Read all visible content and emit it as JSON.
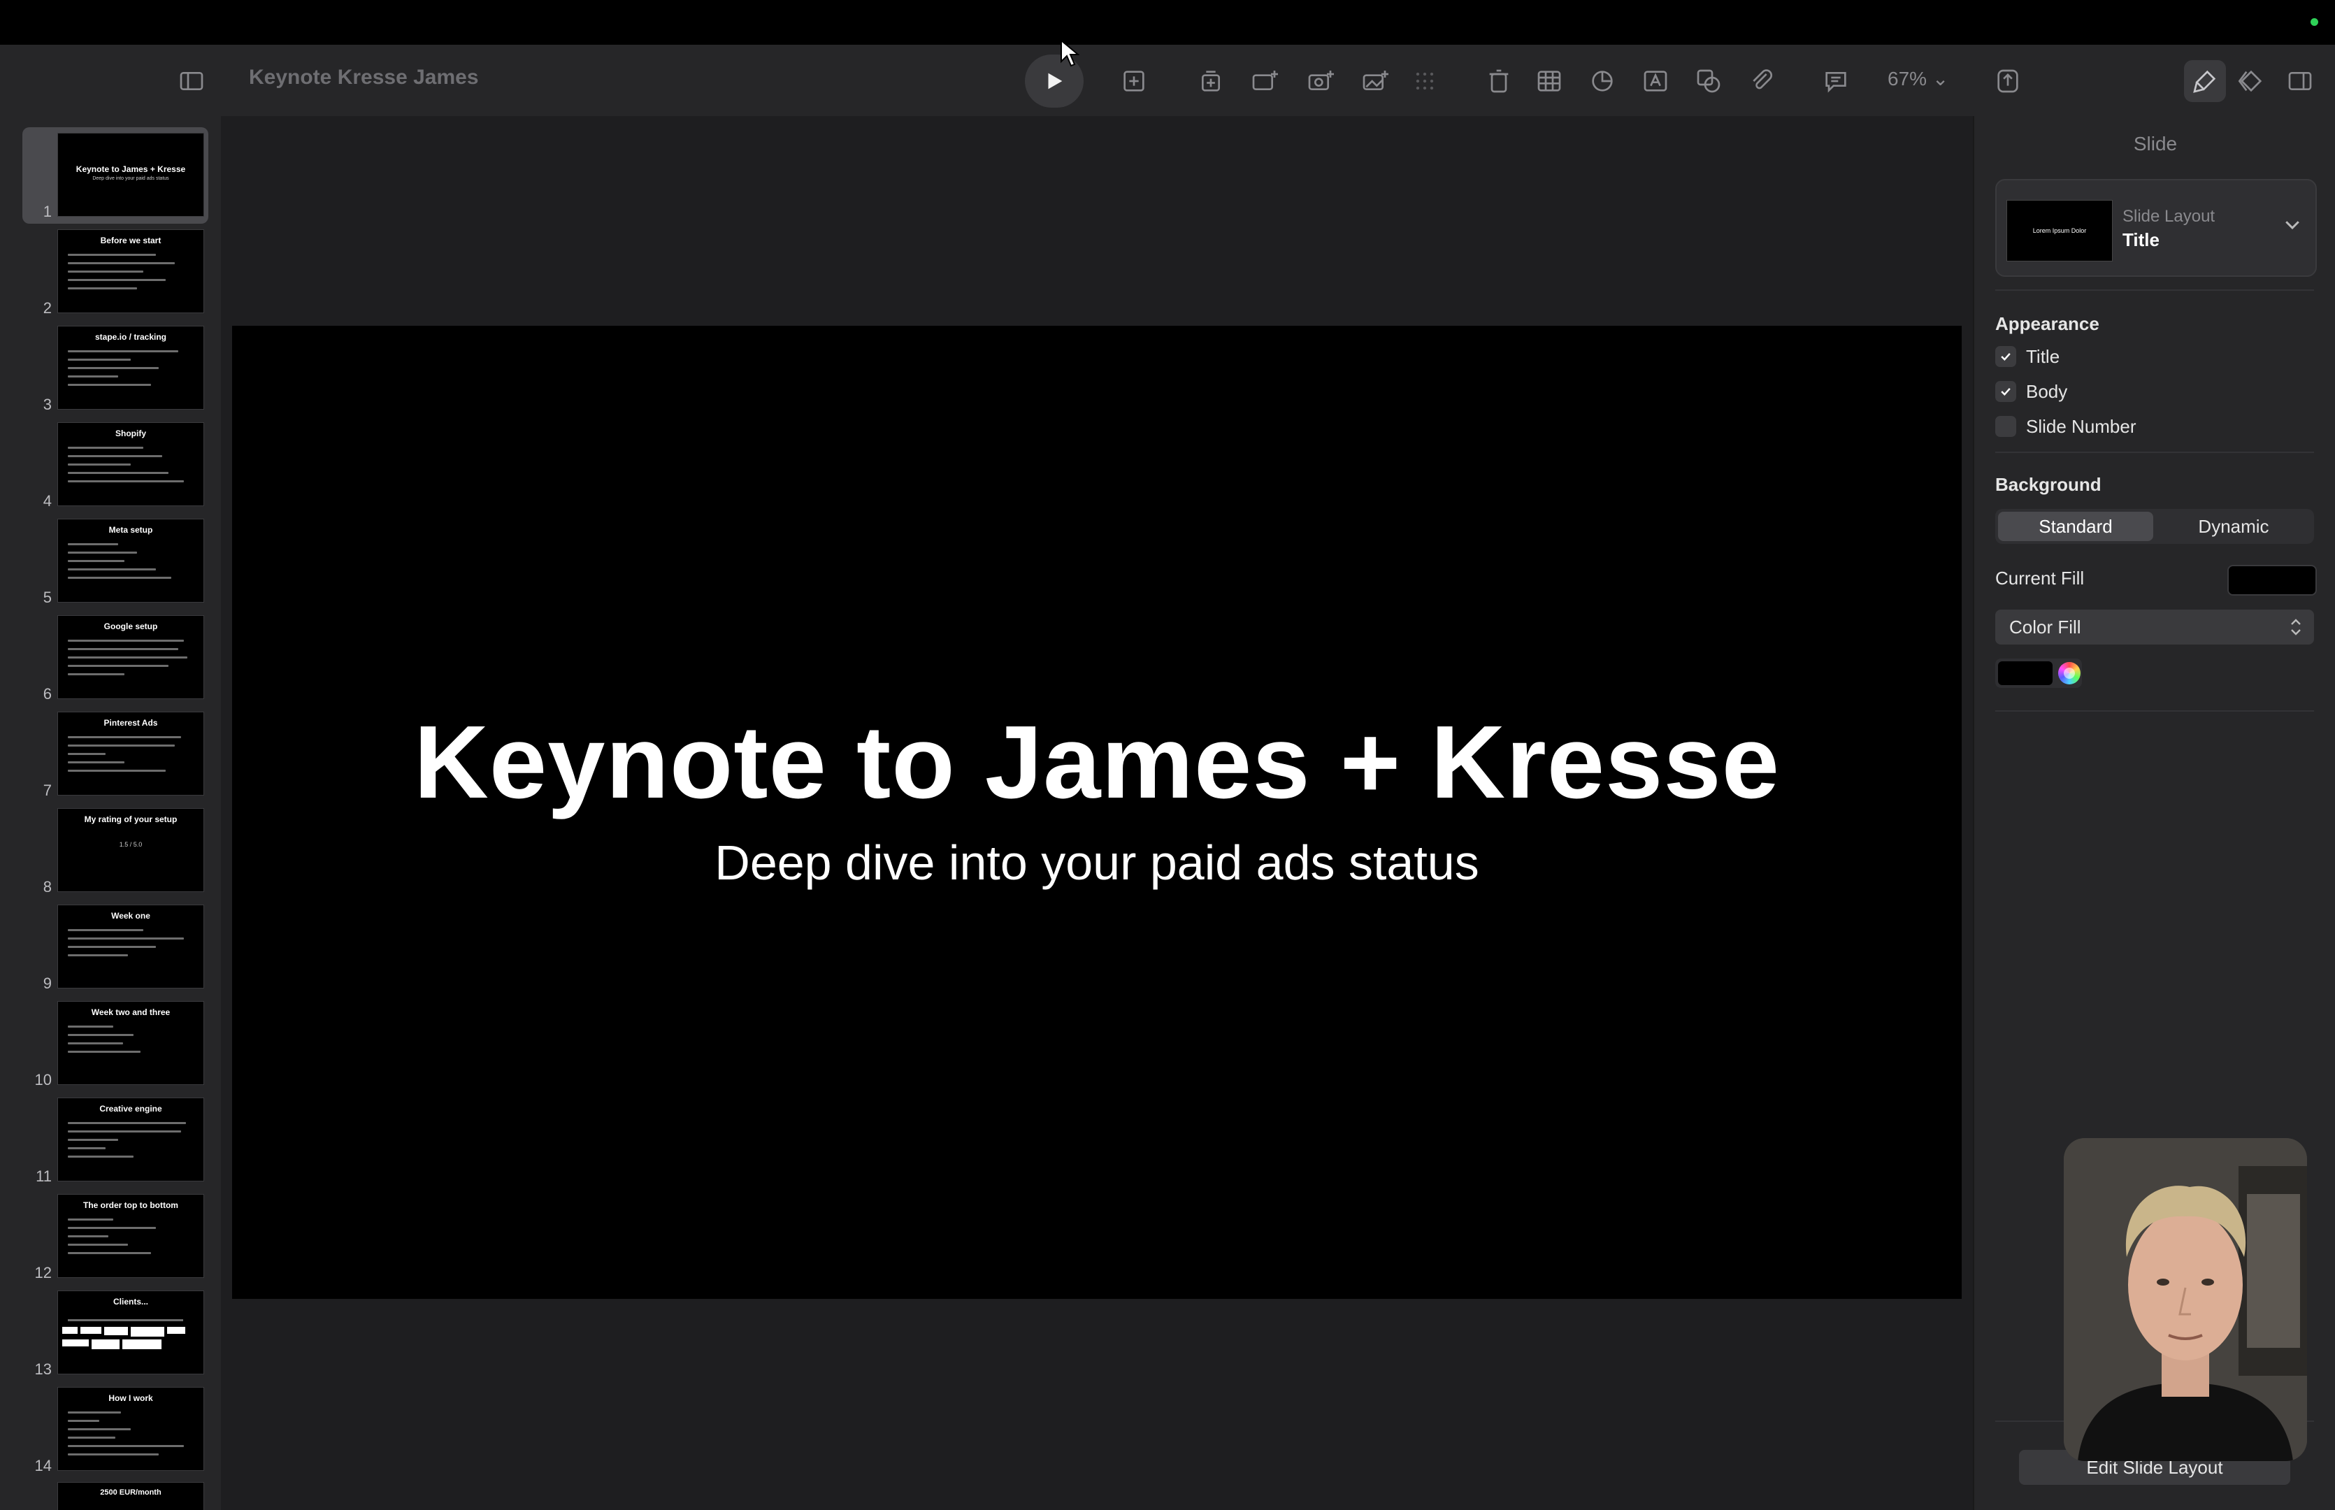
{
  "document": {
    "title": "Keynote Kresse James",
    "zoom": "67%"
  },
  "toolbar": {
    "icons": [
      "sidebar-icon",
      "play-icon",
      "add-slide-icon",
      "duplicate-icon",
      "adjust-icon",
      "photo-add-icon",
      "photo-icon",
      "grid-icon",
      "trash-icon",
      "table-icon",
      "chart-icon",
      "text-icon",
      "shape-icon",
      "media-icon",
      "comment-icon",
      "zoom-icon",
      "share-icon",
      "format-icon",
      "animate-icon",
      "document-icon"
    ]
  },
  "navigator": {
    "selected": 1,
    "slides": [
      {
        "number": "1",
        "title": "Keynote to James + Kresse",
        "subtitle": "Deep dive into your paid ads status"
      },
      {
        "number": "2",
        "title": "Before we start"
      },
      {
        "number": "3",
        "title": "stape.io / tracking"
      },
      {
        "number": "4",
        "title": "Shopify"
      },
      {
        "number": "5",
        "title": "Meta setup"
      },
      {
        "number": "6",
        "title": "Google setup"
      },
      {
        "number": "7",
        "title": "Pinterest Ads"
      },
      {
        "number": "8",
        "title": "My rating of your setup",
        "subtitle": "1.5 / 5.0"
      },
      {
        "number": "9",
        "title": "Week one"
      },
      {
        "number": "10",
        "title": "Week two and three"
      },
      {
        "number": "11",
        "title": "Creative engine"
      },
      {
        "number": "12",
        "title": "The order top to bottom"
      },
      {
        "number": "13",
        "title": "Clients..."
      },
      {
        "number": "14",
        "title": "How I work"
      },
      {
        "number": "",
        "title": "2500 EUR/month"
      }
    ]
  },
  "slide": {
    "title": "Keynote to James + Kresse",
    "subtitle": "Deep dive into your paid ads status"
  },
  "inspector": {
    "tab": "Slide",
    "layout_thumb_text": "Lorem Ipsum Dolor",
    "layout_label": "Slide Layout",
    "layout_value": "Title",
    "appearance_title": "Appearance",
    "appearance": [
      {
        "label": "Title",
        "checked": true
      },
      {
        "label": "Body",
        "checked": true
      },
      {
        "label": "Slide Number",
        "checked": false
      }
    ],
    "background_title": "Background",
    "segment_standard": "Standard",
    "segment_dynamic": "Dynamic",
    "current_fill_label": "Current Fill",
    "fill_color": "#000000",
    "fill_type": "Color Fill",
    "edit_layout_button": "Edit Slide Layout"
  },
  "colors": {
    "accent": "#2fd158",
    "slide_bg": "#000000",
    "app_bg": "#1c1c1e"
  }
}
